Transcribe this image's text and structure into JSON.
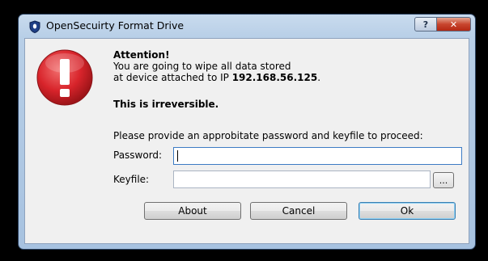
{
  "window": {
    "title": "OpenSecuirty Format Drive"
  },
  "titlebar": {
    "help_label": "?",
    "close_label": "✕"
  },
  "icons": {
    "app": "shield-icon",
    "warning": "warning-icon"
  },
  "message": {
    "heading": "Attention!",
    "line1": "You are going to wipe all data stored",
    "line2_prefix": "at device attached to IP ",
    "ip_address": "192.168.56.125",
    "line2_suffix": ".",
    "irreversible": "This is irreversible.",
    "instruction": "Please provide an approbitate password and keyfile to proceed:"
  },
  "form": {
    "password_label": "Password:",
    "password_value": "",
    "keyfile_label": "Keyfile:",
    "keyfile_value": "",
    "browse_label": "..."
  },
  "buttons": {
    "about": "About",
    "cancel": "Cancel",
    "ok": "Ok"
  },
  "colors": {
    "warning_red": "#d8242b",
    "accent_blue": "#3d7bc4",
    "close_red": "#c8452e"
  }
}
